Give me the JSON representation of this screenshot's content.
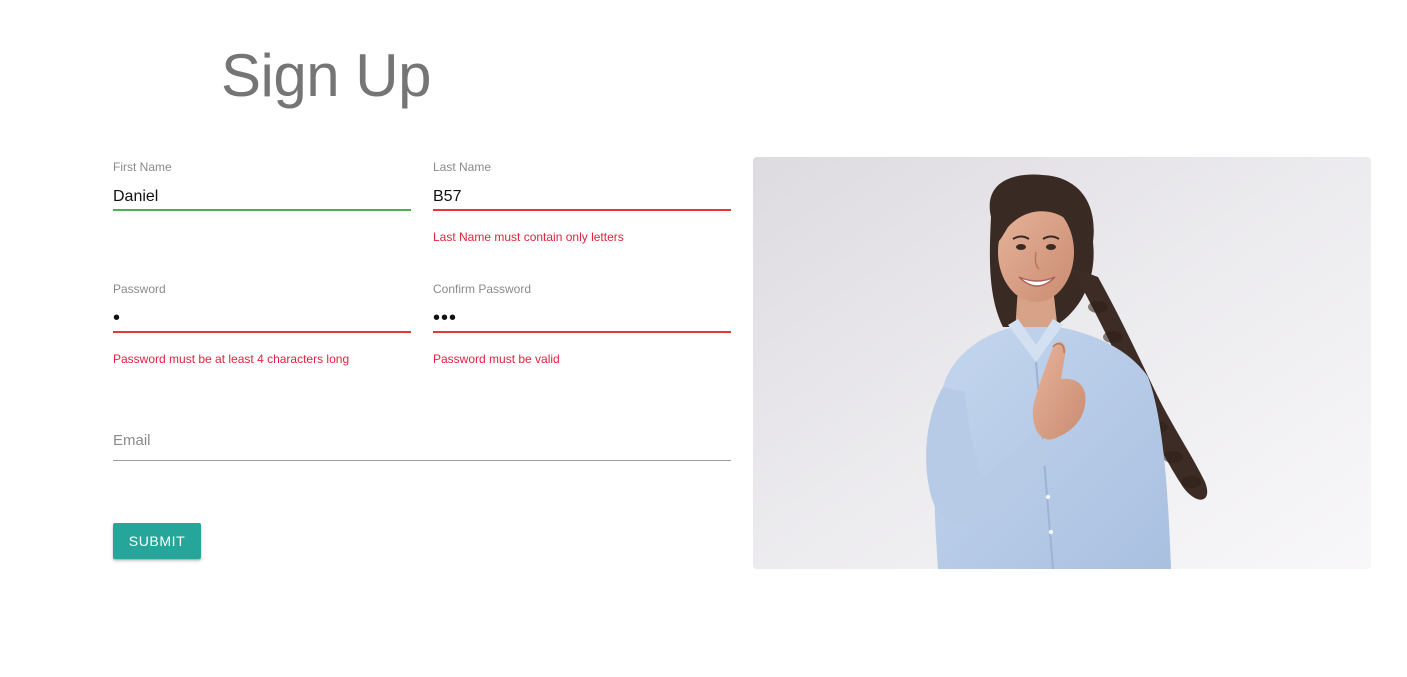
{
  "page": {
    "title": "Sign Up"
  },
  "form": {
    "first_name": {
      "label": "First Name",
      "value": "Daniel",
      "state": "valid"
    },
    "last_name": {
      "label": "Last Name",
      "value": "B57",
      "state": "error",
      "error": "Last Name must contain only letters"
    },
    "password": {
      "label": "Password",
      "value": "•",
      "state": "error",
      "error": "Password must be at least 4 characters long"
    },
    "confirm_password": {
      "label": "Confirm Password",
      "value": "•••",
      "state": "error",
      "error": "Password must be valid"
    },
    "email": {
      "placeholder": "Email",
      "value": ""
    },
    "submit_label": "Submit"
  },
  "colors": {
    "title": "#757575",
    "valid_line": "#4caf50",
    "error_line": "#e53935",
    "error_text": "#e0243c",
    "button": "#26a69a"
  }
}
